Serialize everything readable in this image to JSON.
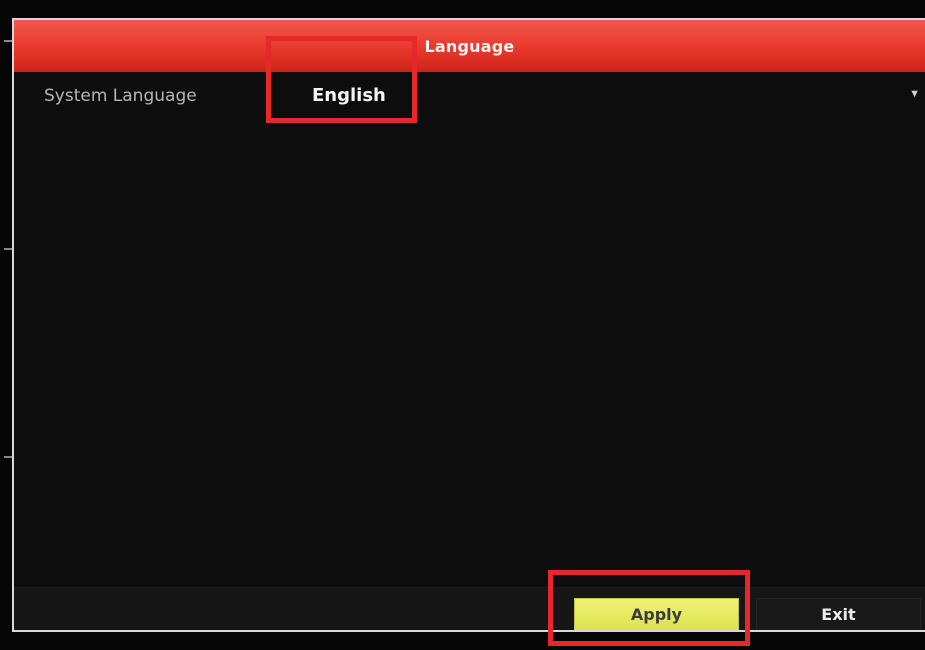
{
  "dialog": {
    "title": "Language"
  },
  "settings": {
    "system_language": {
      "label": "System Language",
      "value": "English"
    }
  },
  "footer": {
    "apply_label": "Apply",
    "exit_label": "Exit"
  },
  "icons": {
    "dropdown": "chevron-down-icon"
  },
  "colors": {
    "titlebar": "#e8382c",
    "apply_button": "#e6e960",
    "highlight": "#e6282a",
    "background": "#0b0b0b"
  }
}
